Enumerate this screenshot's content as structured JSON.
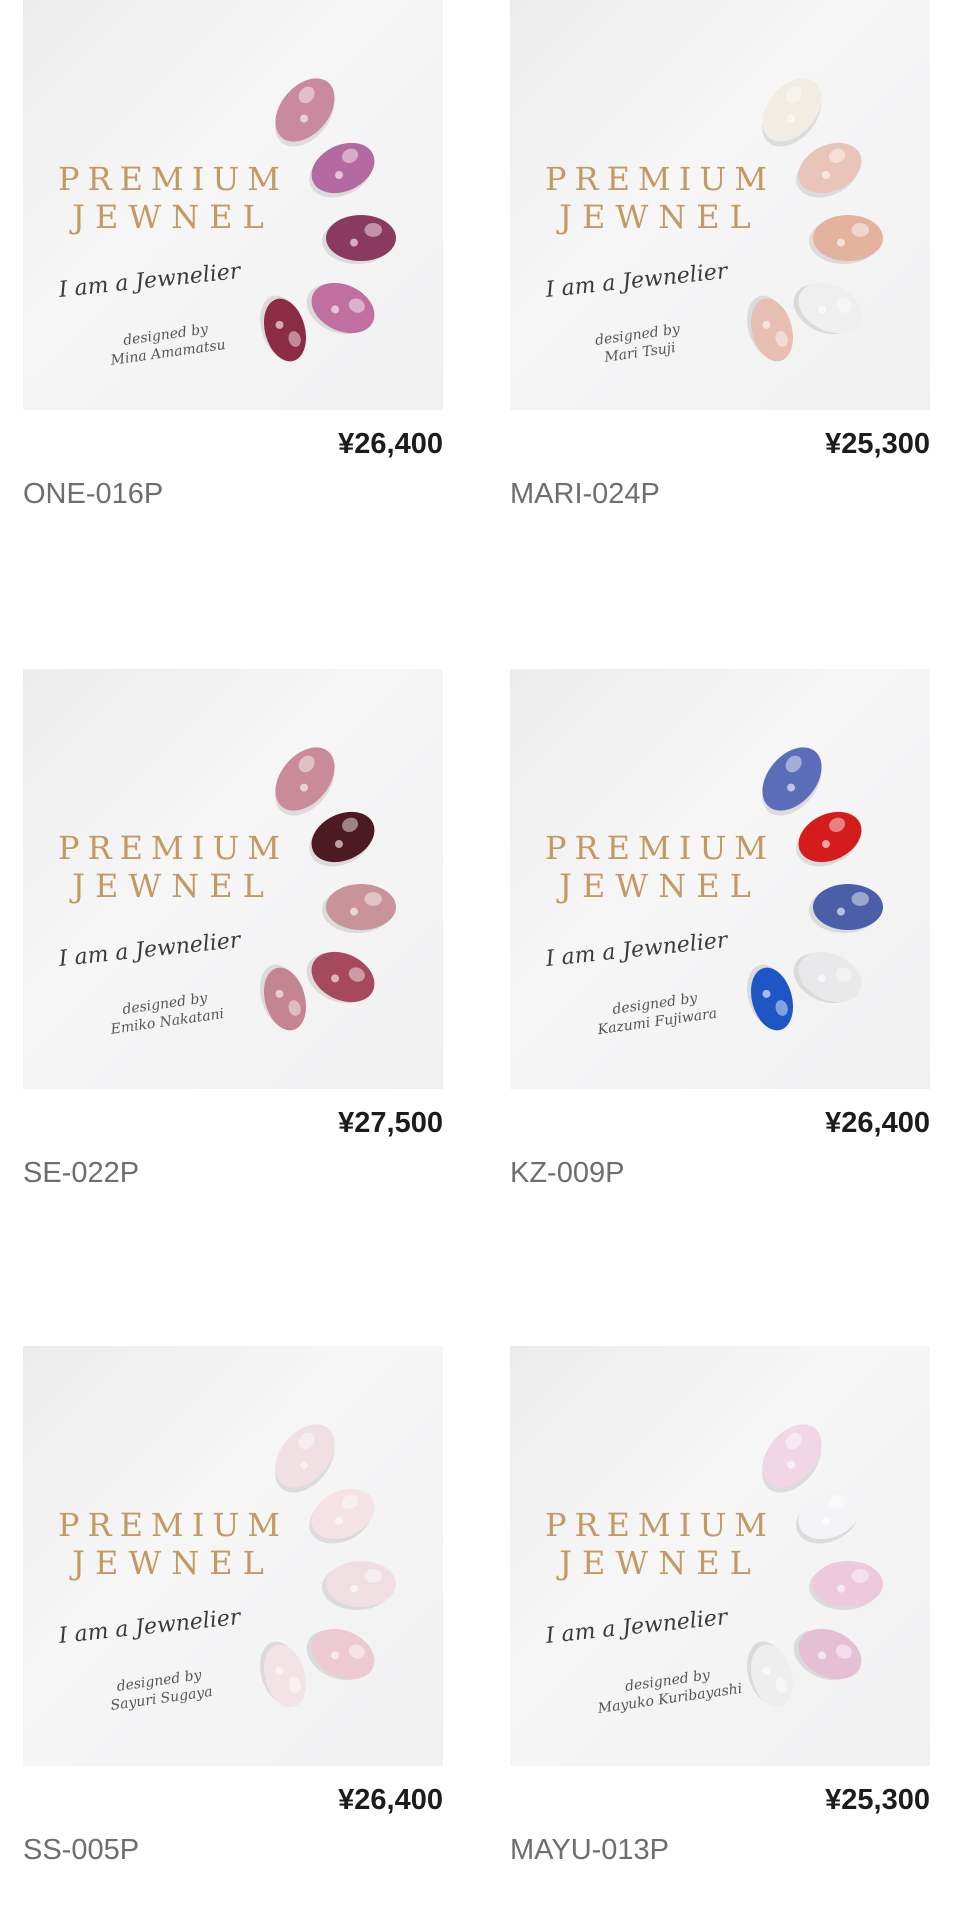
{
  "products": [
    {
      "brand_line1": "PREMIUM",
      "brand_line2": "JEWNEL",
      "tagline": "I am a Jewnelier",
      "designed_by": "designed by",
      "designer": "Mina Amamatsu",
      "price": "¥26,400",
      "code": "ONE-016P",
      "colors": [
        "#c9899e",
        "#b26aa1",
        "#8a3a5e",
        "#c06fa0",
        "#8b2b45"
      ]
    },
    {
      "brand_line1": "PREMIUM",
      "brand_line2": "JEWNEL",
      "tagline": "I am a Jewnelier",
      "designed_by": "designed by",
      "designer": "Mari Tsuji",
      "price": "¥25,300",
      "code": "MARI-024P",
      "colors": [
        "#f1ece4",
        "#e9c4b8",
        "#e3b3a0",
        "#f0efef",
        "#e7beb2"
      ]
    },
    {
      "brand_line1": "PREMIUM",
      "brand_line2": "JEWNEL",
      "tagline": "I am a Jewnelier",
      "designed_by": "designed by",
      "designer": "Emiko Nakatani",
      "price": "¥27,500",
      "code": "SE-022P",
      "colors": [
        "#c98a99",
        "#4b1a23",
        "#c9939b",
        "#a6485e",
        "#c48492"
      ]
    },
    {
      "brand_line1": "PREMIUM",
      "brand_line2": "JEWNEL",
      "tagline": "I am a Jewnelier",
      "designed_by": "designed by",
      "designer": "Kazumi Fujiwara",
      "price": "¥26,400",
      "code": "KZ-009P",
      "colors": [
        "#5b6cb8",
        "#d51c1c",
        "#4a5fa8",
        "#e9e8ea",
        "#1f56c6"
      ]
    },
    {
      "brand_line1": "PREMIUM",
      "brand_line2": "JEWNEL",
      "tagline": "I am a Jewnelier",
      "designed_by": "designed by",
      "designer": "Sayuri Sugaya",
      "price": "¥26,400",
      "code": "SS-005P",
      "colors": [
        "#f0dfe3",
        "#f4e2e4",
        "#efdfe3",
        "#edc9d1",
        "#f2e4e6"
      ]
    },
    {
      "brand_line1": "PREMIUM",
      "brand_line2": "JEWNEL",
      "tagline": "I am a Jewnelier",
      "designed_by": "designed by",
      "designer": "Mayuko Kuribayashi",
      "price": "¥25,300",
      "code": "MAYU-013P",
      "colors": [
        "#f1d6e6",
        "#f4f4f6",
        "#edc9dc",
        "#e5bfd4",
        "#eeeeef"
      ]
    }
  ]
}
